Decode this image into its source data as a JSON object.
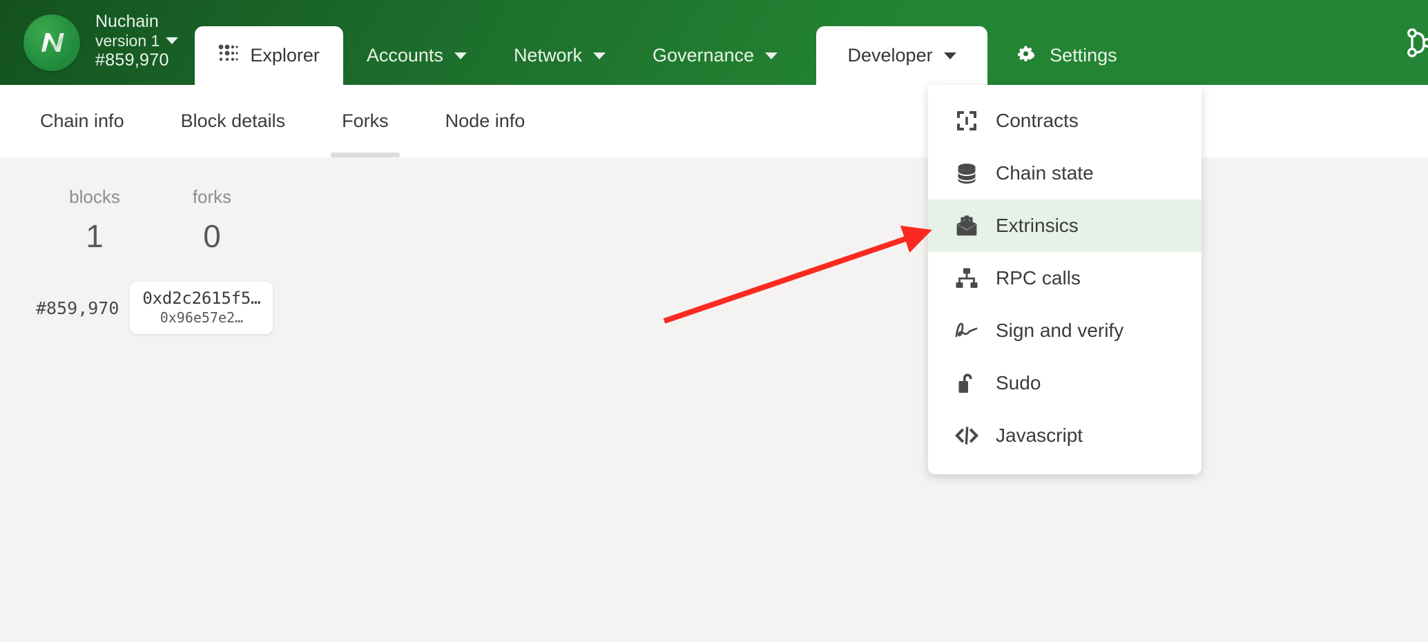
{
  "brand": {
    "name": "Nuchain",
    "version": "version 1",
    "block": "#859,970",
    "logo_icon": "nuchain-logo-icon",
    "chain_caret_icon": "chevron-down-icon"
  },
  "nav": {
    "items": [
      {
        "label": "Explorer",
        "icon": "dot-grid-icon",
        "active": true,
        "has_caret": false
      },
      {
        "label": "Accounts",
        "icon": "chevron-down-icon",
        "active": false,
        "has_caret": true
      },
      {
        "label": "Network",
        "icon": "chevron-down-icon",
        "active": false,
        "has_caret": true
      },
      {
        "label": "Governance",
        "icon": "chevron-down-icon",
        "active": false,
        "has_caret": true
      },
      {
        "label": "Developer",
        "icon": "chevron-down-icon",
        "active": true,
        "has_caret": true
      },
      {
        "label": "Settings",
        "icon": "gear-icon",
        "active": false,
        "has_caret": false
      }
    ],
    "right_icon": "git-branch-icon"
  },
  "tabs": [
    {
      "label": "Chain info",
      "active": false
    },
    {
      "label": "Block details",
      "active": false
    },
    {
      "label": "Forks",
      "active": true
    },
    {
      "label": "Node info",
      "active": false
    }
  ],
  "stats": [
    {
      "label": "blocks",
      "value": "1"
    },
    {
      "label": "forks",
      "value": "0"
    }
  ],
  "block_row": {
    "number": "#859,970",
    "hash_main": "0xd2c2615f5…",
    "hash_sub": "0x96e57e2…"
  },
  "developer_menu": {
    "items": [
      {
        "label": "Contracts",
        "icon": "contracts-frame-icon",
        "highlighted": false
      },
      {
        "label": "Chain state",
        "icon": "database-icon",
        "highlighted": false
      },
      {
        "label": "Extrinsics",
        "icon": "envelope-open-doc-icon",
        "highlighted": true
      },
      {
        "label": "RPC calls",
        "icon": "sitemap-icon",
        "highlighted": false
      },
      {
        "label": "Sign and verify",
        "icon": "signature-icon",
        "highlighted": false
      },
      {
        "label": "Sudo",
        "icon": "unlock-icon",
        "highlighted": false
      },
      {
        "label": "Javascript",
        "icon": "code-icon",
        "highlighted": false
      }
    ]
  },
  "annotation": {
    "arrow_color": "#fb2a20",
    "points_to": "Extrinsics"
  },
  "colors": {
    "header_green_dark": "#14521f",
    "header_green": "#248537",
    "page_background": "#f4f3f1",
    "menu_highlight": "#e6f1e7",
    "accent_red": "#fb2a20"
  }
}
